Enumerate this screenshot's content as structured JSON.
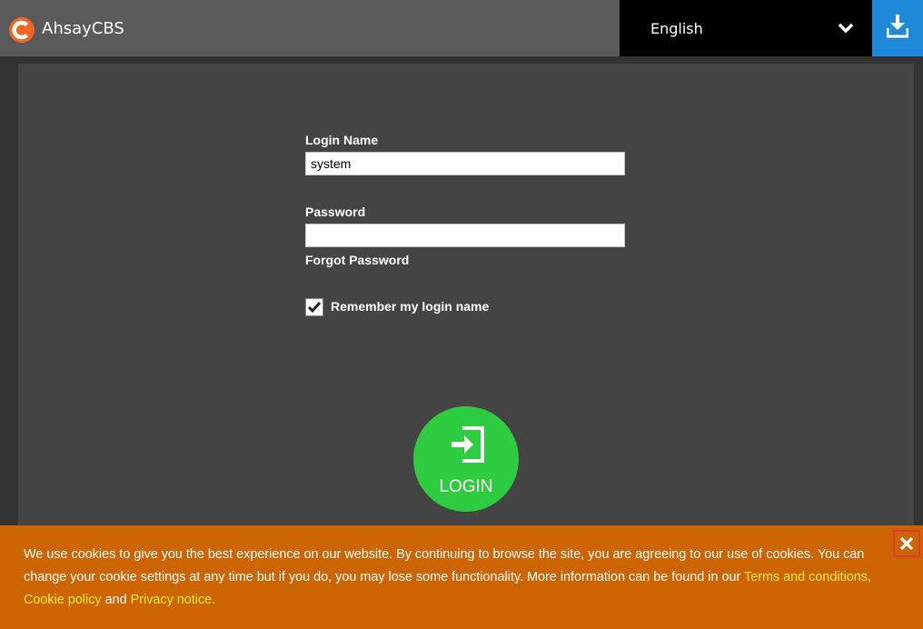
{
  "header": {
    "app_title": "AhsayCBS",
    "logo_icon": "ahsay-c-logo",
    "language": "English",
    "language_icon": "chevron-down-icon",
    "download_icon": "download-icon"
  },
  "login_form": {
    "login_name_label": "Login Name",
    "login_name_value": "system",
    "password_label": "Password",
    "password_value": "",
    "forgot_password": "Forgot Password",
    "remember_checked": true,
    "remember_label": "Remember my login name",
    "login_button": "LOGIN",
    "login_icon": "sign-in-icon"
  },
  "cookie_banner": {
    "text_before": "We use cookies to give you the best experience on our website. By continuing to browse the site, you are agreeing to our use of cookies. You can change your cookie settings at any time but if you do, you may lose some functionality. More information can be found in our ",
    "terms_link": "Terms and conditions",
    "sep1": ", ",
    "cookie_policy_link": "Cookie policy",
    "sep2": " and ",
    "privacy_link": "Privacy notice",
    "end": ".",
    "close_icon": "close-icon"
  },
  "colors": {
    "header_bg": "#5a5a5a",
    "language_bg": "#000000",
    "download_bg": "#1e88d9",
    "logo_orange": "#f26522",
    "panel_bg": "#444444",
    "login_green": "#2ecc40",
    "cookie_bg": "#cc6400",
    "link_yellow": "#ffeb3b",
    "close_border": "#e53935"
  }
}
